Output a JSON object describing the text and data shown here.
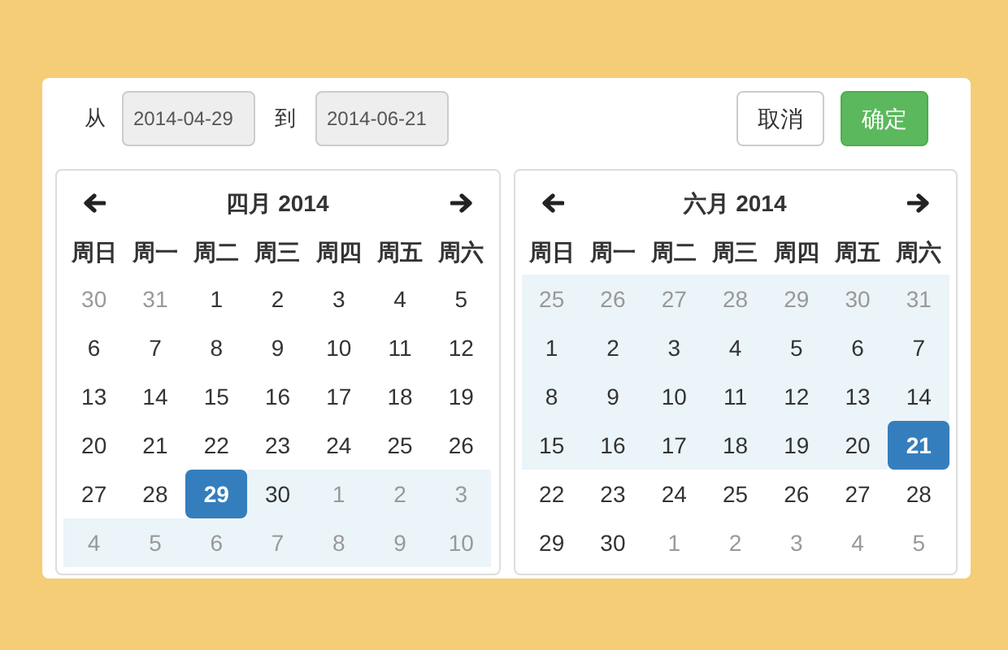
{
  "range": {
    "from_label": "从",
    "from_value": "2014-04-29",
    "to_label": "到",
    "to_value": "2014-06-21"
  },
  "buttons": [
    {
      "label": "取消",
      "kind": "default"
    },
    {
      "label": "确定",
      "kind": "primary"
    }
  ],
  "calendars": [
    {
      "title": "四月 2014",
      "weekdays": [
        "周日",
        "周一",
        "周二",
        "周三",
        "周四",
        "周五",
        "周六"
      ],
      "days": [
        {
          "text": "30",
          "muted": true,
          "in_range": false,
          "selected": false
        },
        {
          "text": "31",
          "muted": true,
          "in_range": false,
          "selected": false
        },
        {
          "text": "1",
          "muted": false,
          "in_range": false,
          "selected": false
        },
        {
          "text": "2",
          "muted": false,
          "in_range": false,
          "selected": false
        },
        {
          "text": "3",
          "muted": false,
          "in_range": false,
          "selected": false
        },
        {
          "text": "4",
          "muted": false,
          "in_range": false,
          "selected": false
        },
        {
          "text": "5",
          "muted": false,
          "in_range": false,
          "selected": false
        },
        {
          "text": "6",
          "muted": false,
          "in_range": false,
          "selected": false
        },
        {
          "text": "7",
          "muted": false,
          "in_range": false,
          "selected": false
        },
        {
          "text": "8",
          "muted": false,
          "in_range": false,
          "selected": false
        },
        {
          "text": "9",
          "muted": false,
          "in_range": false,
          "selected": false
        },
        {
          "text": "10",
          "muted": false,
          "in_range": false,
          "selected": false
        },
        {
          "text": "11",
          "muted": false,
          "in_range": false,
          "selected": false
        },
        {
          "text": "12",
          "muted": false,
          "in_range": false,
          "selected": false
        },
        {
          "text": "13",
          "muted": false,
          "in_range": false,
          "selected": false
        },
        {
          "text": "14",
          "muted": false,
          "in_range": false,
          "selected": false
        },
        {
          "text": "15",
          "muted": false,
          "in_range": false,
          "selected": false
        },
        {
          "text": "16",
          "muted": false,
          "in_range": false,
          "selected": false
        },
        {
          "text": "17",
          "muted": false,
          "in_range": false,
          "selected": false
        },
        {
          "text": "18",
          "muted": false,
          "in_range": false,
          "selected": false
        },
        {
          "text": "19",
          "muted": false,
          "in_range": false,
          "selected": false
        },
        {
          "text": "20",
          "muted": false,
          "in_range": false,
          "selected": false
        },
        {
          "text": "21",
          "muted": false,
          "in_range": false,
          "selected": false
        },
        {
          "text": "22",
          "muted": false,
          "in_range": false,
          "selected": false
        },
        {
          "text": "23",
          "muted": false,
          "in_range": false,
          "selected": false
        },
        {
          "text": "24",
          "muted": false,
          "in_range": false,
          "selected": false
        },
        {
          "text": "25",
          "muted": false,
          "in_range": false,
          "selected": false
        },
        {
          "text": "26",
          "muted": false,
          "in_range": false,
          "selected": false
        },
        {
          "text": "27",
          "muted": false,
          "in_range": false,
          "selected": false
        },
        {
          "text": "28",
          "muted": false,
          "in_range": false,
          "selected": false
        },
        {
          "text": "29",
          "muted": false,
          "in_range": false,
          "selected": true
        },
        {
          "text": "30",
          "muted": false,
          "in_range": true,
          "selected": false
        },
        {
          "text": "1",
          "muted": true,
          "in_range": true,
          "selected": false
        },
        {
          "text": "2",
          "muted": true,
          "in_range": true,
          "selected": false
        },
        {
          "text": "3",
          "muted": true,
          "in_range": true,
          "selected": false
        },
        {
          "text": "4",
          "muted": true,
          "in_range": true,
          "selected": false
        },
        {
          "text": "5",
          "muted": true,
          "in_range": true,
          "selected": false
        },
        {
          "text": "6",
          "muted": true,
          "in_range": true,
          "selected": false
        },
        {
          "text": "7",
          "muted": true,
          "in_range": true,
          "selected": false
        },
        {
          "text": "8",
          "muted": true,
          "in_range": true,
          "selected": false
        },
        {
          "text": "9",
          "muted": true,
          "in_range": true,
          "selected": false
        },
        {
          "text": "10",
          "muted": true,
          "in_range": true,
          "selected": false
        }
      ]
    },
    {
      "title": "六月 2014",
      "weekdays": [
        "周日",
        "周一",
        "周二",
        "周三",
        "周四",
        "周五",
        "周六"
      ],
      "days": [
        {
          "text": "25",
          "muted": true,
          "in_range": true,
          "selected": false
        },
        {
          "text": "26",
          "muted": true,
          "in_range": true,
          "selected": false
        },
        {
          "text": "27",
          "muted": true,
          "in_range": true,
          "selected": false
        },
        {
          "text": "28",
          "muted": true,
          "in_range": true,
          "selected": false
        },
        {
          "text": "29",
          "muted": true,
          "in_range": true,
          "selected": false
        },
        {
          "text": "30",
          "muted": true,
          "in_range": true,
          "selected": false
        },
        {
          "text": "31",
          "muted": true,
          "in_range": true,
          "selected": false
        },
        {
          "text": "1",
          "muted": false,
          "in_range": true,
          "selected": false
        },
        {
          "text": "2",
          "muted": false,
          "in_range": true,
          "selected": false
        },
        {
          "text": "3",
          "muted": false,
          "in_range": true,
          "selected": false
        },
        {
          "text": "4",
          "muted": false,
          "in_range": true,
          "selected": false
        },
        {
          "text": "5",
          "muted": false,
          "in_range": true,
          "selected": false
        },
        {
          "text": "6",
          "muted": false,
          "in_range": true,
          "selected": false
        },
        {
          "text": "7",
          "muted": false,
          "in_range": true,
          "selected": false
        },
        {
          "text": "8",
          "muted": false,
          "in_range": true,
          "selected": false
        },
        {
          "text": "9",
          "muted": false,
          "in_range": true,
          "selected": false
        },
        {
          "text": "10",
          "muted": false,
          "in_range": true,
          "selected": false
        },
        {
          "text": "11",
          "muted": false,
          "in_range": true,
          "selected": false
        },
        {
          "text": "12",
          "muted": false,
          "in_range": true,
          "selected": false
        },
        {
          "text": "13",
          "muted": false,
          "in_range": true,
          "selected": false
        },
        {
          "text": "14",
          "muted": false,
          "in_range": true,
          "selected": false
        },
        {
          "text": "15",
          "muted": false,
          "in_range": true,
          "selected": false
        },
        {
          "text": "16",
          "muted": false,
          "in_range": true,
          "selected": false
        },
        {
          "text": "17",
          "muted": false,
          "in_range": true,
          "selected": false
        },
        {
          "text": "18",
          "muted": false,
          "in_range": true,
          "selected": false
        },
        {
          "text": "19",
          "muted": false,
          "in_range": true,
          "selected": false
        },
        {
          "text": "20",
          "muted": false,
          "in_range": true,
          "selected": false
        },
        {
          "text": "21",
          "muted": false,
          "in_range": false,
          "selected": true
        },
        {
          "text": "22",
          "muted": false,
          "in_range": false,
          "selected": false
        },
        {
          "text": "23",
          "muted": false,
          "in_range": false,
          "selected": false
        },
        {
          "text": "24",
          "muted": false,
          "in_range": false,
          "selected": false
        },
        {
          "text": "25",
          "muted": false,
          "in_range": false,
          "selected": false
        },
        {
          "text": "26",
          "muted": false,
          "in_range": false,
          "selected": false
        },
        {
          "text": "27",
          "muted": false,
          "in_range": false,
          "selected": false
        },
        {
          "text": "28",
          "muted": false,
          "in_range": false,
          "selected": false
        },
        {
          "text": "29",
          "muted": false,
          "in_range": false,
          "selected": false
        },
        {
          "text": "30",
          "muted": false,
          "in_range": false,
          "selected": false
        },
        {
          "text": "1",
          "muted": true,
          "in_range": false,
          "selected": false
        },
        {
          "text": "2",
          "muted": true,
          "in_range": false,
          "selected": false
        },
        {
          "text": "3",
          "muted": true,
          "in_range": false,
          "selected": false
        },
        {
          "text": "4",
          "muted": true,
          "in_range": false,
          "selected": false
        },
        {
          "text": "5",
          "muted": true,
          "in_range": false,
          "selected": false
        }
      ]
    }
  ]
}
